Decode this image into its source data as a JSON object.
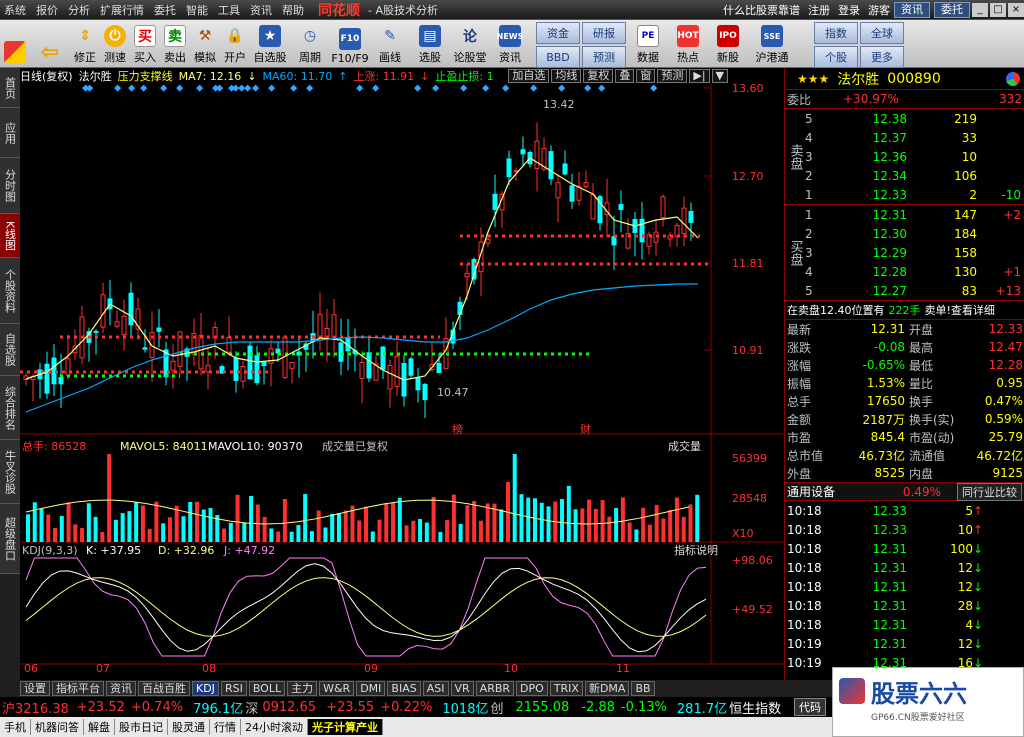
{
  "titlebar": {
    "menu": [
      "系统",
      "报价",
      "分析",
      "扩展行情",
      "委托",
      "智能",
      "工具",
      "资讯",
      "帮助"
    ],
    "logo": "同花顺",
    "title": "- A股技术分析",
    "links": [
      "什么比股票靠谱",
      "注册",
      "登录",
      "游客"
    ],
    "buttons": [
      "资讯",
      "委托"
    ]
  },
  "toolbar": {
    "buttons": [
      "修正",
      "测速",
      "买入",
      "卖出",
      "模拟",
      "开户",
      "自选股",
      "周期",
      "F10/F9",
      "画线",
      "选股",
      "论股堂",
      "资讯"
    ],
    "grid": [
      "资金",
      "研报",
      "BBD",
      "预测"
    ],
    "icons": [
      "数据",
      "热点",
      "新股",
      "沪港通"
    ],
    "right": [
      "指数",
      "全球",
      "个股",
      "更多"
    ]
  },
  "sidebar": {
    "items": [
      "首页",
      "应用",
      "分时图",
      "K线图",
      "个股资料",
      "自选股",
      "综合排名",
      "牛叉诊股",
      "超级盘口"
    ],
    "active": 3
  },
  "chart": {
    "period": "日线(复权)",
    "name": "法尔胜",
    "indicator": "压力支撑线",
    "ma7": "MA7: 12.16",
    "ma60": "MA60: 11.70",
    "up": "上涨: 11.91",
    "stop": "止盈止损: 1",
    "buttons": [
      "加自选",
      "均线",
      "复权",
      "叠",
      "窗",
      "预测"
    ],
    "price_labels": [
      "13.60",
      "12.70",
      "11.81",
      "10.91"
    ],
    "high_label": "13.42",
    "low_label": "10.47",
    "event_marks": [
      "榜",
      "财"
    ],
    "vol_info": {
      "total": "总手: 86528",
      "mavol5": "MAVOL5: 84011",
      "mavol10": "MAVOL10: 90370",
      "note": "成交量已复权",
      "button": "成交量"
    },
    "vol_labels": [
      "56399",
      "28548",
      "X10"
    ],
    "kdj_info": {
      "title": "KDJ(9,3,3)",
      "k": "K: +37.95",
      "d": "D: +32.96",
      "j": "J: +47.92",
      "button": "指标说明"
    },
    "kdj_labels": [
      "+98.06",
      "+49.52"
    ],
    "months": [
      "06",
      "07",
      "08",
      "09",
      "10",
      "11"
    ],
    "colors": {
      "up": "#ff3030",
      "down": "#00ffff",
      "ma7": "#ffff80",
      "ma60": "#00aaff"
    }
  },
  "chart_data": {
    "type": "candlestick",
    "series": [
      {
        "name": "MA7",
        "values": [
          10.75,
          10.82,
          10.98,
          11.2,
          11.5,
          11.38,
          11.08,
          10.98,
          11.02,
          11.08,
          10.96,
          10.92,
          10.94,
          11.05,
          11.16,
          11.14,
          10.98,
          10.84,
          10.74,
          10.78,
          11.04,
          11.58,
          12.22,
          12.72,
          12.96,
          12.83,
          12.7,
          12.6,
          12.34,
          12.28,
          12.34,
          12.37,
          12.16
        ]
      },
      {
        "name": "MA60",
        "values": [
          10.42,
          10.5,
          10.58,
          10.66,
          10.76,
          10.86,
          10.94,
          11.0,
          11.06,
          11.1,
          11.12,
          11.12,
          11.12,
          11.12,
          11.14,
          11.16,
          11.17,
          11.16,
          11.14,
          11.12,
          11.12,
          11.16,
          11.24,
          11.34,
          11.45,
          11.54,
          11.6,
          11.64,
          11.66,
          11.68,
          11.69,
          11.7,
          11.7
        ]
      }
    ]
  },
  "quote": {
    "name": "法尔胜",
    "code": "000890",
    "weibi_label": "委比",
    "weibi": "+30.97%",
    "weicha": "332",
    "sell": [
      {
        "n": "5",
        "p": "12.38",
        "v": "219",
        "c": ""
      },
      {
        "n": "4",
        "p": "12.37",
        "v": "33",
        "c": ""
      },
      {
        "n": "3",
        "p": "12.36",
        "v": "10",
        "c": ""
      },
      {
        "n": "2",
        "p": "12.34",
        "v": "106",
        "c": ""
      },
      {
        "n": "1",
        "p": "12.33",
        "v": "2",
        "c": "-10"
      }
    ],
    "buy": [
      {
        "n": "1",
        "p": "12.31",
        "v": "147",
        "c": "+2"
      },
      {
        "n": "2",
        "p": "12.30",
        "v": "184",
        "c": ""
      },
      {
        "n": "3",
        "p": "12.29",
        "v": "158",
        "c": ""
      },
      {
        "n": "4",
        "p": "12.28",
        "v": "130",
        "c": "+1"
      },
      {
        "n": "5",
        "p": "12.27",
        "v": "83",
        "c": "+13"
      }
    ],
    "sell_label": "卖盘",
    "buy_label": "买盘",
    "notice": "在卖盘12.40位置有",
    "notice_vol": "222手",
    "notice_tail": "卖单!查看详细",
    "stats": [
      [
        "最新",
        "12.31",
        "开盘",
        "12.33"
      ],
      [
        "涨跌",
        "-0.08",
        "最高",
        "12.47"
      ],
      [
        "涨幅",
        "-0.65%",
        "最低",
        "12.28"
      ],
      [
        "振幅",
        "1.53%",
        "量比",
        "0.95"
      ],
      [
        "总手",
        "17650",
        "换手",
        "0.47%"
      ],
      [
        "金额",
        "2187万",
        "换手(实)",
        "0.59%"
      ],
      [
        "市盈",
        "845.4",
        "市盈(动)",
        "25.79"
      ],
      [
        "总市值",
        "46.73亿",
        "流通值",
        "46.72亿"
      ],
      [
        "外盘",
        "8525",
        "内盘",
        "9125"
      ]
    ],
    "industry": "通用设备",
    "industry_pct": "0.49%",
    "industry_btn": "同行业比较",
    "ticks": [
      [
        "10:18",
        "12.33",
        "5"
      ],
      [
        "10:18",
        "12.33",
        "10"
      ],
      [
        "10:18",
        "12.31",
        "100"
      ],
      [
        "10:18",
        "12.31",
        "12"
      ],
      [
        "10:18",
        "12.31",
        "12"
      ],
      [
        "10:18",
        "12.31",
        "28"
      ],
      [
        "10:18",
        "12.31",
        "4"
      ],
      [
        "10:19",
        "12.31",
        "12"
      ],
      [
        "10:19",
        "12.31",
        "16"
      ]
    ]
  },
  "bottomtabs": [
    "设置",
    "指标平台",
    "资讯",
    "百战百胜",
    "KDJ",
    "RSI",
    "BOLL",
    "主力",
    "W&R",
    "DMI",
    "BIAS",
    "ASI",
    "VR",
    "ARBR",
    "DPO",
    "TRIX",
    "新DMA",
    "BB"
  ],
  "ticker": {
    "sh": "沪3216.38",
    "sh_chg": "+23.52",
    "sh_pct": "+0.74%",
    "sh_amt": "796.1亿",
    "sz": "深",
    "sz_val": "0912.65",
    "sz_chg": "+23.55",
    "sz_pct": "+0.22%",
    "sz_amt": "1018亿",
    "cy": "创",
    "cy_val": "2155.08",
    "cy_chg": "-2.88",
    "cy_pct": "-0.13%",
    "cy_amt": "281.7亿",
    "hs": "恒生指数",
    "code_label": "代码"
  },
  "statusbar": [
    "手机",
    "机器问答",
    "解盘",
    "股市日记",
    "股灵通",
    "行情",
    "24小时滚动",
    "光子计算产业"
  ],
  "watermark": {
    "brand": "股票六六",
    "url": "GP66.CN股票爱好社区"
  }
}
